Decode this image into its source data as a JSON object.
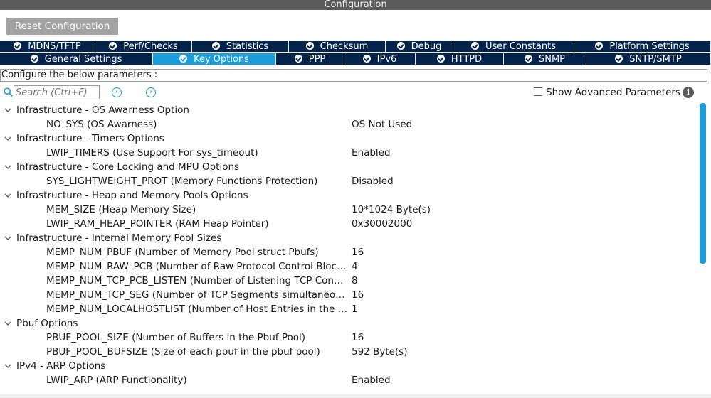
{
  "window": {
    "title": "Configuration"
  },
  "toolbar": {
    "reset_label": "Reset Configuration"
  },
  "tabs": {
    "row1": [
      {
        "label": "MDNS/TFTP",
        "width": 134
      },
      {
        "label": "Perf/Checks",
        "width": 136
      },
      {
        "label": "Statistics",
        "width": 136
      },
      {
        "label": "Checksum",
        "width": 136
      },
      {
        "label": "Debug",
        "width": 95
      },
      {
        "label": "User Constants",
        "width": 170
      },
      {
        "label": "Platform Settings",
        "width": 192
      }
    ],
    "row2": [
      {
        "label": "General Settings",
        "width": 215,
        "active": false
      },
      {
        "label": "Key Options",
        "width": 173,
        "active": true
      },
      {
        "label": "PPP",
        "width": 96,
        "active": false
      },
      {
        "label": "IPv6",
        "width": 100,
        "active": false
      },
      {
        "label": "HTTPD",
        "width": 124,
        "active": false
      },
      {
        "label": "SNMP",
        "width": 116,
        "active": false
      },
      {
        "label": "SNTP/SMTP",
        "width": 175,
        "active": false
      }
    ]
  },
  "configure_text": "Configure the below parameters :",
  "search": {
    "placeholder": "Search (Ctrl+F)"
  },
  "advanced": {
    "label": "Show Advanced Parameters",
    "checked": false
  },
  "tree": [
    {
      "type": "group",
      "title": "Infrastructure - OS Awarness Option"
    },
    {
      "type": "param",
      "name": "NO_SYS (OS Awarness)",
      "value": "OS Not Used"
    },
    {
      "type": "group",
      "title": "Infrastructure - Timers Options"
    },
    {
      "type": "param",
      "name": "LWIP_TIMERS (Use Support For sys_timeout)",
      "value": "Enabled"
    },
    {
      "type": "group",
      "title": "Infrastructure - Core Locking and MPU Options"
    },
    {
      "type": "param",
      "name": "SYS_LIGHTWEIGHT_PROT (Memory Functions Protection)",
      "value": "Disabled"
    },
    {
      "type": "group",
      "title": "Infrastructure - Heap and Memory Pools Options"
    },
    {
      "type": "param",
      "name": "MEM_SIZE (Heap Memory Size)",
      "value": "10*1024 Byte(s)"
    },
    {
      "type": "param",
      "name": "LWIP_RAM_HEAP_POINTER (RAM Heap Pointer)",
      "value": "0x30002000"
    },
    {
      "type": "group",
      "title": "Infrastructure - Internal Memory Pool Sizes"
    },
    {
      "type": "param",
      "name": "MEMP_NUM_PBUF (Number of Memory Pool struct Pbufs)",
      "value": "16"
    },
    {
      "type": "param",
      "name": "MEMP_NUM_RAW_PCB (Number of Raw Protocol Control Blocks)",
      "value": "4"
    },
    {
      "type": "param",
      "name": "MEMP_NUM_TCP_PCB_LISTEN (Number of Listening TCP Connecti...",
      "value": "8"
    },
    {
      "type": "param",
      "name": "MEMP_NUM_TCP_SEG (Number of TCP Segments simultaneously ...",
      "value": "16"
    },
    {
      "type": "param",
      "name": "MEMP_NUM_LOCALHOSTLIST (Number of Host Entries in the Loca...",
      "value": "1"
    },
    {
      "type": "group",
      "title": "Pbuf Options"
    },
    {
      "type": "param",
      "name": "PBUF_POOL_SIZE (Number of Buffers in the Pbuf Pool)",
      "value": "16"
    },
    {
      "type": "param",
      "name": "PBUF_POOL_BUFSIZE (Size of each pbuf in the pbuf pool)",
      "value": "592 Byte(s)"
    },
    {
      "type": "group",
      "title": "IPv4 - ARP Options"
    },
    {
      "type": "param",
      "name": "LWIP_ARP (ARP Functionality)",
      "value": "Enabled"
    }
  ],
  "colors": {
    "tab_bg": "#03234b",
    "tab_active": "#1b9bd7",
    "titlebar": "#5b5b5b",
    "reset_btn": "#a3a3a3"
  }
}
